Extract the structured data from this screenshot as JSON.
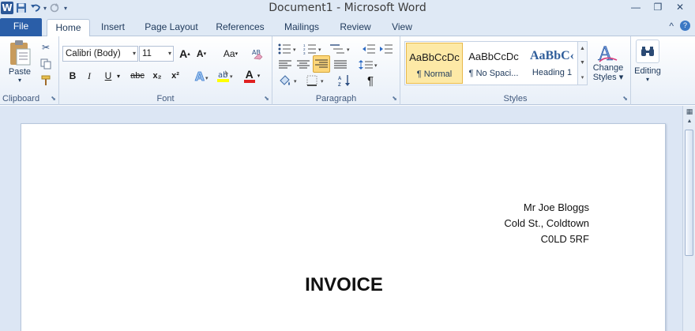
{
  "window": {
    "title": "Document1  -  Microsoft Word",
    "minimize": "—",
    "restore": "❐",
    "close": "✕"
  },
  "qat": {
    "logo": "W",
    "save": "💾",
    "undo": "↶",
    "redo": "↻"
  },
  "tabs": [
    {
      "label": "File"
    },
    {
      "label": "Home"
    },
    {
      "label": "Insert"
    },
    {
      "label": "Page Layout"
    },
    {
      "label": "References"
    },
    {
      "label": "Mailings"
    },
    {
      "label": "Review"
    },
    {
      "label": "View"
    }
  ],
  "ribbon": {
    "clipboard": {
      "label": "Clipboard",
      "paste": "Paste"
    },
    "font": {
      "label": "Font",
      "font_name": "Calibri (Body)",
      "font_size": "11",
      "grow": "A",
      "shrink": "A",
      "change_case": "Aa",
      "bold": "B",
      "italic": "I",
      "underline": "U",
      "strikethrough": "abc",
      "subscript": "x₂",
      "superscript": "x²",
      "font_color": "A"
    },
    "paragraph": {
      "label": "Paragraph",
      "pilcrow": "¶"
    },
    "styles": {
      "label": "Styles",
      "items": [
        {
          "sample": "AaBbCcDc",
          "name": "¶ Normal"
        },
        {
          "sample": "AaBbCcDc",
          "name": "¶ No Spaci..."
        },
        {
          "sample": "AaBbC‹",
          "name": "Heading 1"
        }
      ],
      "change_styles": "Change Styles",
      "change_styles_line1": "Change",
      "change_styles_line2": "Styles ▾"
    },
    "editing": {
      "label": "Editing"
    }
  },
  "document": {
    "address_lines": [
      "Mr Joe Bloggs",
      "Cold St., Coldtown",
      "C0LD 5RF"
    ],
    "heading": "INVOICE"
  }
}
